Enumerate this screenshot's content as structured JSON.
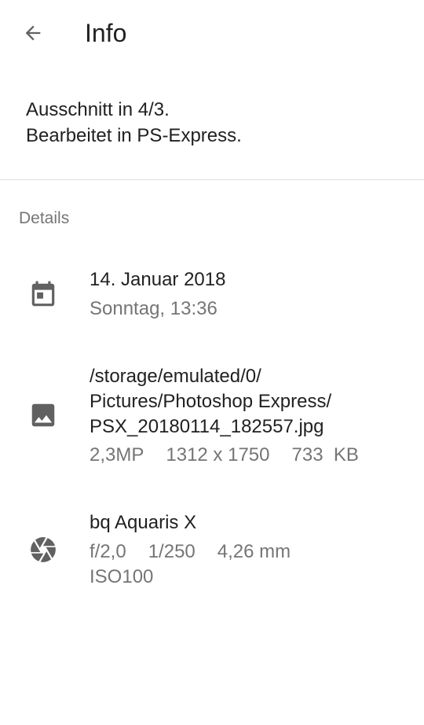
{
  "appbar": {
    "back_icon": "arrow-back-icon",
    "title": "Info"
  },
  "description": {
    "line1": "Ausschnitt in 4/3.",
    "line2": "Bearbeitet in PS-Express."
  },
  "details": {
    "header": "Details",
    "date": {
      "icon": "calendar-icon",
      "primary": "14. Januar 2018",
      "secondary": "Sonntag, 13:36"
    },
    "file": {
      "icon": "image-icon",
      "path_line1": "/storage/emulated/0/",
      "path_line2": "Pictures/Photoshop Express/",
      "path_line3": "PSX_20180114_182557.jpg",
      "megapixels": "2,3MP",
      "resolution": "1312 x 1750",
      "size": "733  KB"
    },
    "camera": {
      "icon": "aperture-icon",
      "model": "bq Aquaris X",
      "aperture": "f/2,0",
      "exposure": "1/250",
      "focal_length": "4,26 mm",
      "iso": "ISO100"
    }
  },
  "colors": {
    "icon": "#616161",
    "primary_text": "#212121",
    "secondary_text": "#757575",
    "divider": "#e0e0e0"
  }
}
